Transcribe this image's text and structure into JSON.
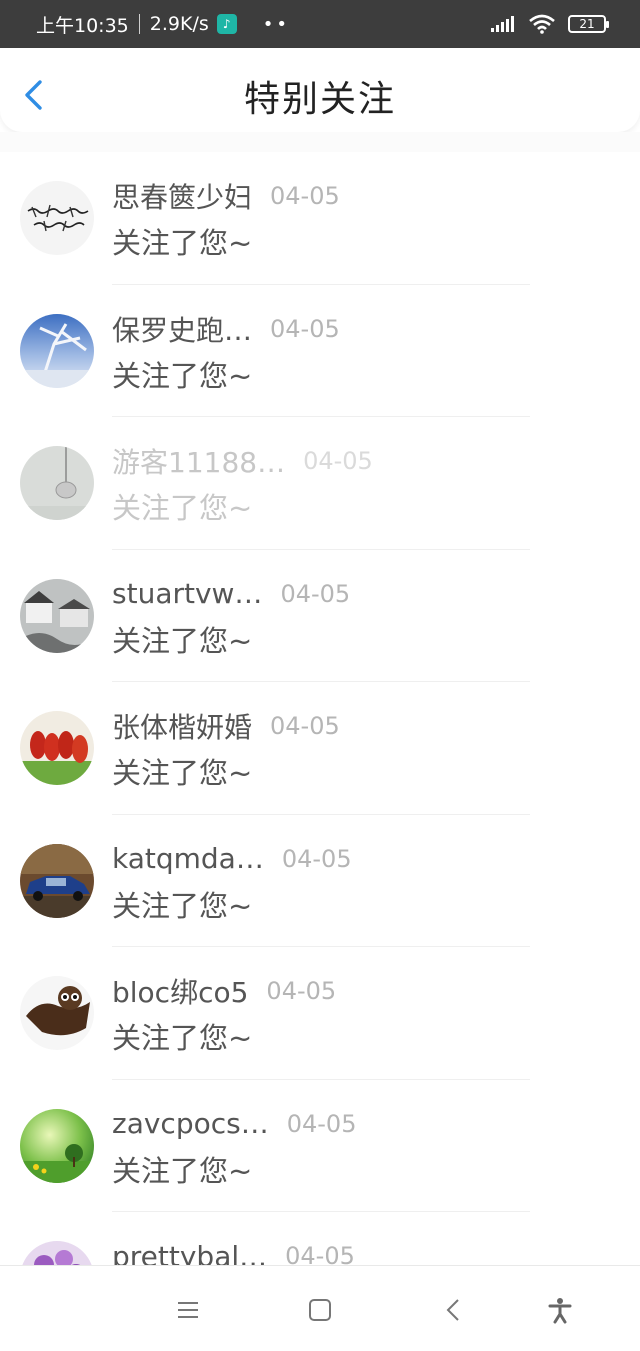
{
  "status_bar": {
    "time": "上午10:35",
    "speed": "2.9K/s",
    "app_icon": "notification-app-icon",
    "dots": "••",
    "battery": "21"
  },
  "header": {
    "title": "特别关注",
    "back_icon": "chevron-left-icon"
  },
  "list": {
    "items": [
      {
        "name": "思春篋少妇",
        "date": "04-05",
        "message": "关注了您~",
        "avatar": "calligraphy-avatar"
      },
      {
        "name": "保罗史跑…",
        "date": "04-05",
        "message": "关注了您~",
        "avatar": "winter-tree-avatar"
      },
      {
        "name": "游客11188…",
        "date": "04-05",
        "message": "关注了您~",
        "avatar": "lamp-avatar"
      },
      {
        "name": "stuartvw…",
        "date": "04-05",
        "message": "关注了您~",
        "avatar": "village-avatar"
      },
      {
        "name": "张体楷妍婚",
        "date": "04-05",
        "message": "关注了您~",
        "avatar": "food-avatar"
      },
      {
        "name": "katqmda…",
        "date": "04-05",
        "message": "关注了您~",
        "avatar": "car-avatar"
      },
      {
        "name": "bloc绑co5",
        "date": "04-05",
        "message": "关注了您~",
        "avatar": "owl-avatar"
      },
      {
        "name": "zavcpocs…",
        "date": "04-05",
        "message": "关注了您~",
        "avatar": "meadow-avatar"
      },
      {
        "name": "prettybal…",
        "date": "04-05",
        "message": "",
        "avatar": "flower-avatar"
      }
    ]
  },
  "nav_bar": {
    "menu_icon": "menu-icon",
    "home_icon": "square-home-icon",
    "back_icon": "back-arrow-icon",
    "accessibility_icon": "accessibility-icon"
  },
  "colors": {
    "status_bar_bg": "#3d3d3d",
    "accent": "#2f8de4",
    "text_primary": "#555555",
    "text_secondary": "#b5b5b5"
  }
}
